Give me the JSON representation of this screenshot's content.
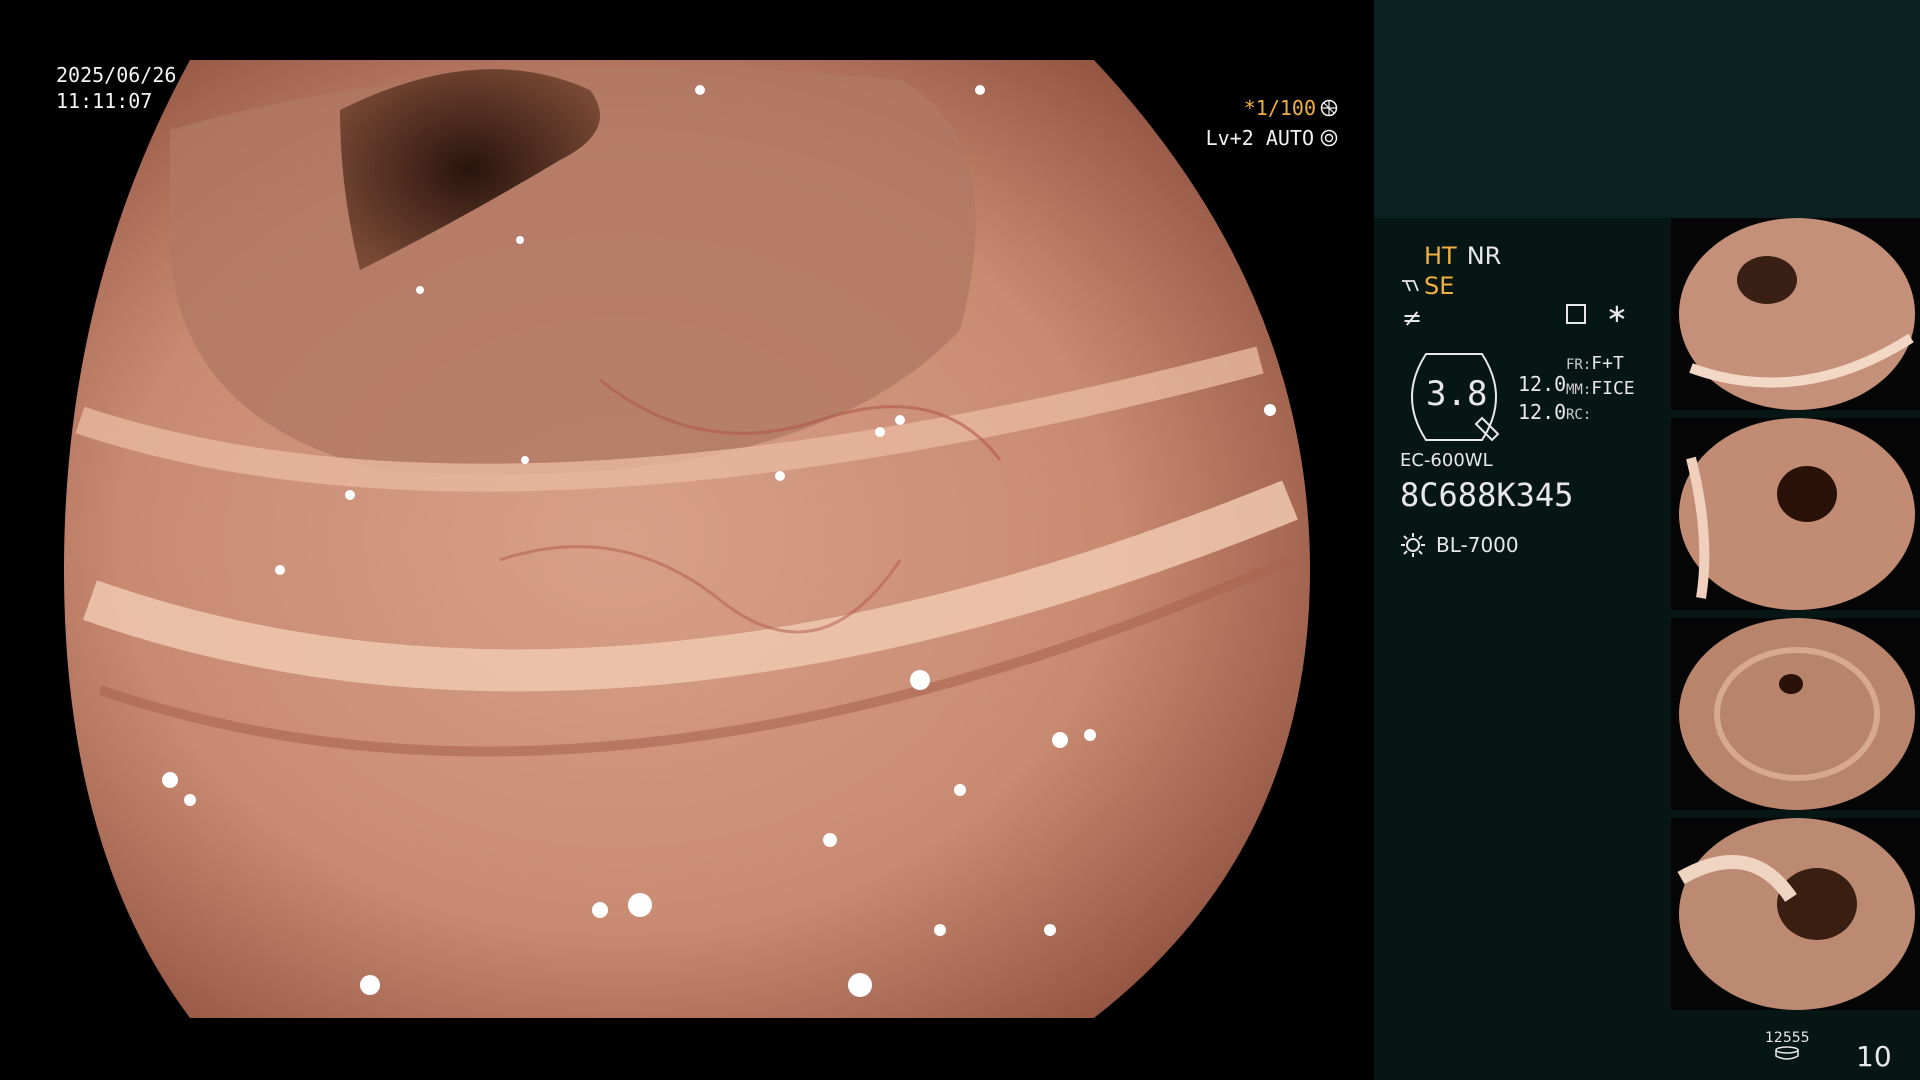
{
  "overlay": {
    "date": "2025/06/26",
    "time": "11:11:07",
    "shutter": "*1/100",
    "level": "Lv+2 AUTO",
    "shutter_icon": "aperture-icon",
    "level_icon": "target-icon"
  },
  "sidebar": {
    "ht_label": "HT",
    "nr_label": "NR",
    "se_label": "SE",
    "gauge_value": "3.8",
    "values": [
      "12.0",
      "12.0"
    ],
    "fr_key": "FR:",
    "fr_value": "F+T",
    "mm_key": "MM:",
    "mm_value": "FICE",
    "rc_key": "RC:",
    "scope_model": "EC-600WL",
    "serial": "8C688K345",
    "light_source": "BL-7000",
    "counter": "12555",
    "page": "10"
  },
  "colors": {
    "accent": "#f0b040",
    "panel": "#061615",
    "panel_top": "#0b2121"
  }
}
